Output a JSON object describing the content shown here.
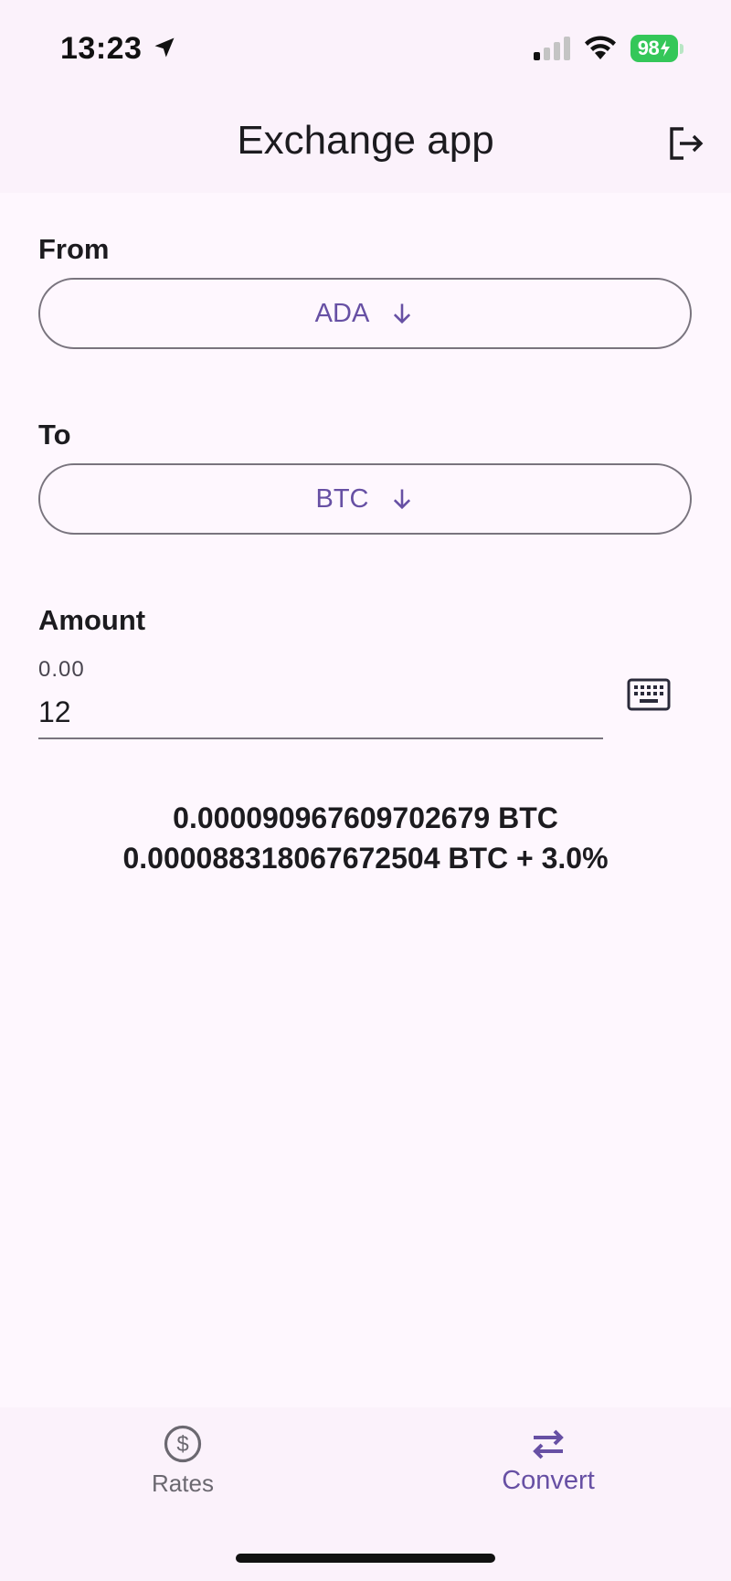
{
  "status_bar": {
    "time": "13:23",
    "battery": "98",
    "icons": [
      "location-arrow-icon",
      "cell-signal-icon",
      "wifi-icon",
      "battery-icon"
    ]
  },
  "app_bar": {
    "title": "Exchange app",
    "action_icon": "logout-icon"
  },
  "form": {
    "from_label": "From",
    "from_value": "ADA",
    "to_label": "To",
    "to_value": "BTC",
    "amount_label": "Amount",
    "amount_placeholder": "0.00",
    "amount_value": "12",
    "keyboard_icon": "keyboard-icon",
    "dropdown_icon": "arrow-down-icon"
  },
  "result": {
    "line1": "0.000090967609702679 BTC",
    "line2": "0.000088318067672504 BTC + 3.0%"
  },
  "bottom_nav": {
    "items": [
      {
        "label": "Rates",
        "icon": "dollar-circle-icon",
        "active": false
      },
      {
        "label": "Convert",
        "icon": "swap-arrows-icon",
        "active": true
      }
    ]
  },
  "colors": {
    "accent": "#6750a4",
    "surface": "#fbf2fb",
    "background": "#fef7fe",
    "battery": "#34c759"
  }
}
